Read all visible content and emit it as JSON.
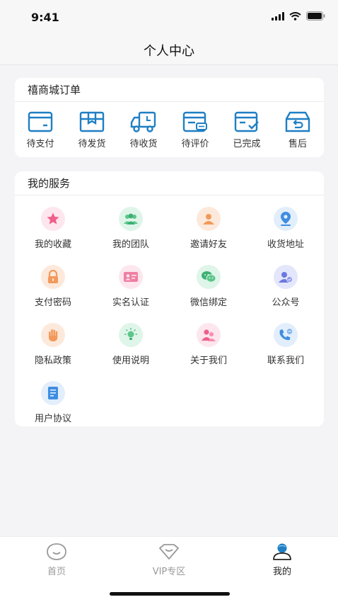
{
  "status_bar": {
    "time": "9:41"
  },
  "header": {
    "title": "个人中心"
  },
  "orders": {
    "title": "禧商城订单",
    "items": [
      {
        "label": "待支付",
        "icon": "wallet-icon"
      },
      {
        "label": "待发货",
        "icon": "box-icon"
      },
      {
        "label": "待收货",
        "icon": "truck-icon"
      },
      {
        "label": "待评价",
        "icon": "review-icon"
      },
      {
        "label": "已完成",
        "icon": "check-box-icon"
      },
      {
        "label": "售后",
        "icon": "return-icon"
      }
    ]
  },
  "services": {
    "title": "我的服务",
    "items": [
      {
        "label": "我的收藏",
        "icon": "star-icon"
      },
      {
        "label": "我的团队",
        "icon": "team-icon"
      },
      {
        "label": "邀请好友",
        "icon": "invite-icon"
      },
      {
        "label": "收货地址",
        "icon": "location-icon"
      },
      {
        "label": "支付密码",
        "icon": "lock-icon"
      },
      {
        "label": "实名认证",
        "icon": "id-card-icon"
      },
      {
        "label": "微信绑定",
        "icon": "wechat-icon"
      },
      {
        "label": "公众号",
        "icon": "official-account-icon"
      },
      {
        "label": "隐私政策",
        "icon": "hand-icon"
      },
      {
        "label": "使用说明",
        "icon": "bulb-icon"
      },
      {
        "label": "关于我们",
        "icon": "about-icon"
      },
      {
        "label": "联系我们",
        "icon": "phone-icon"
      },
      {
        "label": "用户协议",
        "icon": "document-icon"
      }
    ]
  },
  "tabbar": {
    "items": [
      {
        "label": "首页",
        "icon": "home-icon"
      },
      {
        "label": "VIP专区",
        "icon": "vip-icon"
      },
      {
        "label": "我的",
        "icon": "profile-icon"
      }
    ]
  },
  "colors": {
    "accent": "#1f7fc4",
    "background": "#f4f4f6"
  }
}
